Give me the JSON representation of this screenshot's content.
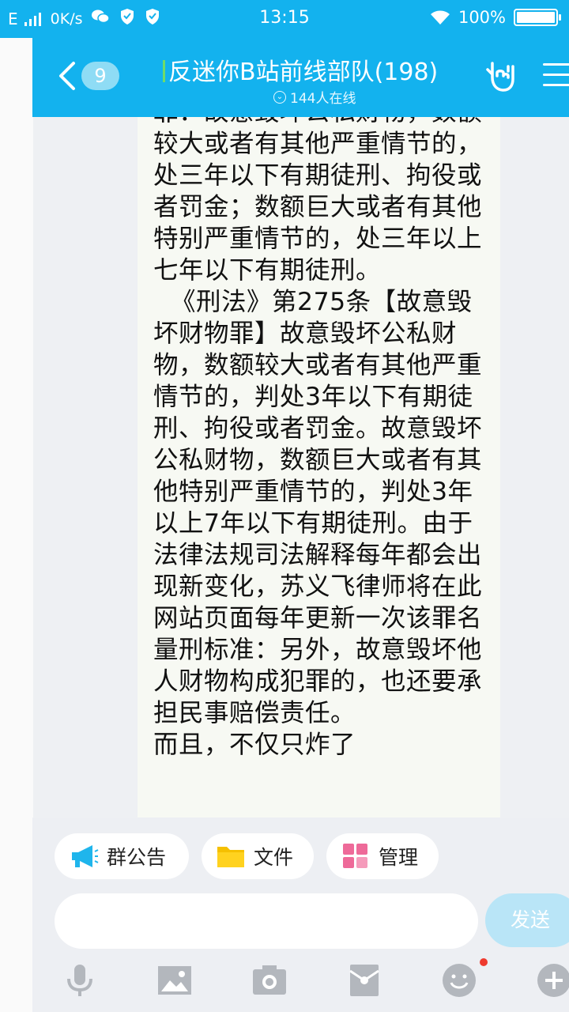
{
  "status_bar": {
    "network": "E",
    "speed": "0K/s",
    "time": "13:15",
    "battery": "100%"
  },
  "header": {
    "back_count": "9",
    "title": "反迷你B站前线部队(198)",
    "online": "144人在线"
  },
  "message": {
    "paragraphs": [
      "罪：故意毁坏公私财物，数额较大或者有其他严重情节的，处三年以下有期徒刑、拘役或者罚金；数额巨大或者有其他特别严重情节的，处三年以上七年以下有期徒刑。",
      "《刑法》第275条【故意毁坏财物罪】故意毁坏公私财物，数额较大或者有其他严重情节的，判处3年以下有期徒刑、拘役或者罚金。故意毁坏公私财物，数额巨大或者有其他特别严重情节的，判处3年以上7年以下有期徒刑。由于法律法规司法解释每年都会出现新变化，苏义飞律师将在此网站页面每年更新一次该罪名量刑标准：另外，故意毁坏他人财物构成犯罪的，也还要承担民事赔偿责任。",
      "而且，不仅只炸了"
    ]
  },
  "quick_actions": {
    "notice": "群公告",
    "files": "文件",
    "manage": "管理"
  },
  "composer": {
    "input_value": "",
    "send_label": "发送"
  },
  "toolbar_icons": [
    "mic-icon",
    "image-icon",
    "camera-icon",
    "red-packet-icon",
    "emoji-icon",
    "plus-icon"
  ],
  "colors": {
    "accent": "#13b2ee",
    "bubble": "#f7f9f3",
    "send_disabled": "#b9e5f7",
    "badge": "#ee3a2e"
  }
}
